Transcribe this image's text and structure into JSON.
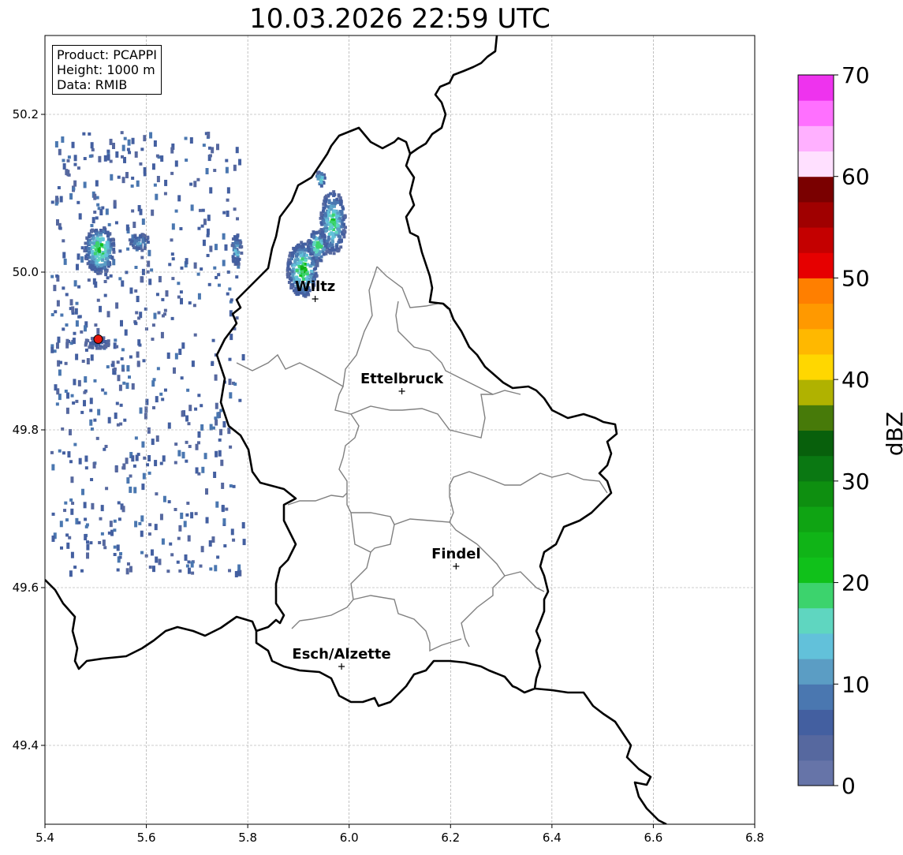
{
  "title": "10.03.2026 22:59 UTC",
  "info": {
    "product": "Product: PCAPPI",
    "height": "Height: 1000 m",
    "data": "Data: RMIB"
  },
  "colorbar": {
    "label": "dBZ",
    "min": 0,
    "max": 70,
    "step": 2.5,
    "ticks": [
      "0",
      "10",
      "20",
      "30",
      "40",
      "50",
      "60",
      "70"
    ],
    "colors": [
      "#6674a8",
      "#56689f",
      "#435fa0",
      "#4a77b0",
      "#5b9dc4",
      "#62c1da",
      "#5fd6c0",
      "#3cd36d",
      "#10c11a",
      "#10b417",
      "#0fa413",
      "#0e8f10",
      "#0a7812",
      "#08600c",
      "#477a09",
      "#b0b200",
      "#ffd700",
      "#ffb800",
      "#ff9900",
      "#ff7f00",
      "#e60000",
      "#c40000",
      "#a00000",
      "#7a0000",
      "#ffe0ff",
      "#ffb0ff",
      "#ff70ff",
      "#ee33ee"
    ]
  },
  "chart_data": {
    "type": "map",
    "xlim": [
      5.4,
      6.8
    ],
    "ylim": [
      49.3,
      50.3
    ],
    "xticks": [
      "5.4",
      "5.6",
      "5.8",
      "6.0",
      "6.2",
      "6.4",
      "6.6",
      "6.8"
    ],
    "yticks": [
      "49.4",
      "49.6",
      "49.8",
      "50.0",
      "50.2"
    ],
    "grid": true,
    "radar_site": {
      "lon": 5.505,
      "lat": 49.915
    },
    "cities": [
      {
        "name": "Wiltz",
        "lon": 5.933,
        "lat": 49.966
      },
      {
        "name": "Ettelbruck",
        "lon": 6.104,
        "lat": 49.849
      },
      {
        "name": "Findel",
        "lon": 6.211,
        "lat": 49.627
      },
      {
        "name": "Esch/Alzette",
        "lon": 5.985,
        "lat": 49.5
      }
    ],
    "echo_cells": [
      {
        "lon": 5.505,
        "lat": 50.03,
        "rlon": 0.03,
        "rlat": 0.03,
        "max_dbz": 28
      },
      {
        "lon": 5.905,
        "lat": 50.005,
        "rlon": 0.03,
        "rlat": 0.035,
        "max_dbz": 28
      },
      {
        "lon": 5.935,
        "lat": 50.035,
        "rlon": 0.02,
        "rlat": 0.02,
        "max_dbz": 26
      },
      {
        "lon": 5.965,
        "lat": 50.065,
        "rlon": 0.025,
        "rlat": 0.04,
        "max_dbz": 24
      },
      {
        "lon": 5.585,
        "lat": 50.04,
        "rlon": 0.02,
        "rlat": 0.01,
        "max_dbz": 16
      },
      {
        "lon": 5.5,
        "lat": 49.912,
        "rlon": 0.025,
        "rlat": 0.008,
        "max_dbz": 8
      },
      {
        "lon": 5.94,
        "lat": 50.12,
        "rlon": 0.01,
        "rlat": 0.01,
        "max_dbz": 22
      },
      {
        "lon": 5.775,
        "lat": 50.03,
        "rlon": 0.01,
        "rlat": 0.02,
        "max_dbz": 18
      }
    ]
  }
}
